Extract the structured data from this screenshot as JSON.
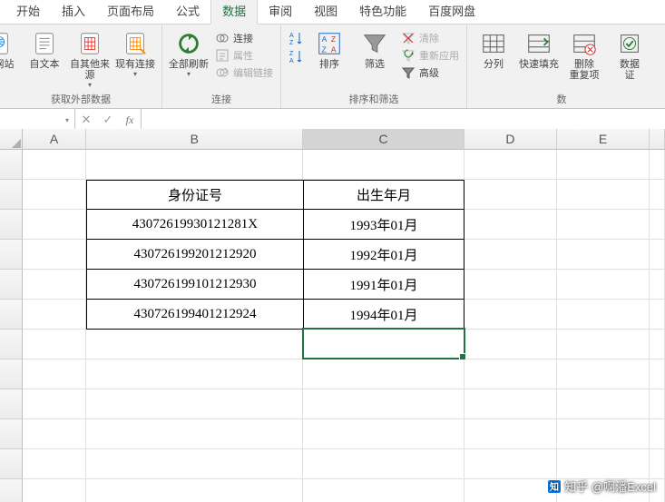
{
  "tabs": [
    "开始",
    "插入",
    "页面布局",
    "公式",
    "数据",
    "审阅",
    "视图",
    "特色功能",
    "百度网盘"
  ],
  "active_tab_index": 4,
  "ribbon": {
    "g1": {
      "label": "获取外部数据",
      "btns": [
        "自网站",
        "自文本",
        "自其他来源",
        "现有连接"
      ]
    },
    "g2": {
      "label": "连接",
      "refresh": "全部刷新",
      "items": [
        "连接",
        "属性",
        "编辑链接"
      ]
    },
    "g3": {
      "label": "排序和筛选",
      "sort_small": [
        "A→Z",
        "Z→A"
      ],
      "sort": "排序",
      "filter": "筛选",
      "adv": [
        "清除",
        "重新应用",
        "高级"
      ]
    },
    "g4": {
      "label": "数",
      "btns": [
        "分列",
        "快速填充",
        "删除\n重复项",
        "数据\n证"
      ]
    }
  },
  "formula_bar": {
    "name": "",
    "value": ""
  },
  "columns": [
    "A",
    "B",
    "C",
    "D",
    "E",
    ""
  ],
  "row_count": 12,
  "selected_col_index": 2,
  "active_cell": {
    "row_index": 6,
    "col_index": 2
  },
  "table": {
    "start_row": 1,
    "start_col": 1,
    "headers": [
      "身份证号",
      "出生年月"
    ],
    "rows": [
      [
        "43072619930121281X",
        "1993年01月"
      ],
      [
        "430726199201212920",
        "1992年01月"
      ],
      [
        "430726199101212930",
        "1991年01月"
      ],
      [
        "430726199401212924",
        "1994年01月"
      ]
    ]
  },
  "watermark": "知乎 @啊潘Excel"
}
